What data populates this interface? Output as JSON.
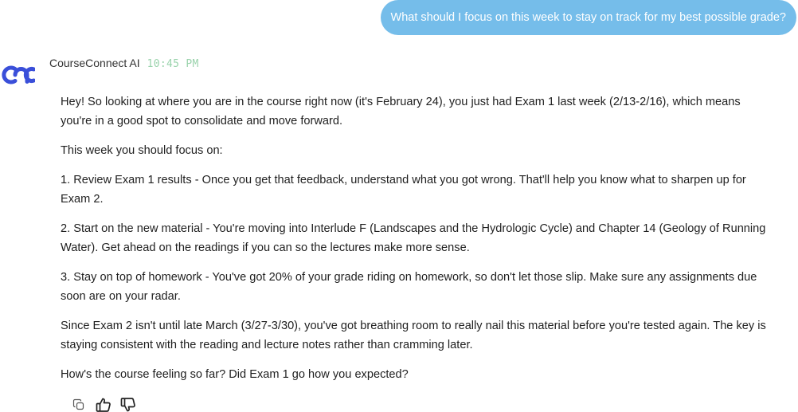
{
  "user_message": {
    "text": "What should I focus on this week to stay on track for my best possible grade?"
  },
  "assistant": {
    "name": "CourseConnect AI",
    "time": "10:45 PM",
    "avatar_icon": "courseconnect-logo",
    "paragraphs": [
      "Hey! So looking at where you are in the course right now (it's February 24), you just had Exam 1 last week (2/13-2/16), which means you're in a good spot to consolidate and move forward.",
      "This week you should focus on:",
      "1. Review Exam 1 results - Once you get that feedback, understand what you got wrong. That'll help you know what to sharpen up for Exam 2.",
      "2. Start on the new material - You're moving into Interlude F (Landscapes and the Hydrologic Cycle) and Chapter 14 (Geology of Running Water). Get ahead on the readings if you can so the lectures make more sense.",
      "3. Stay on top of homework - You've got 20% of your grade riding on homework, so don't let those slip. Make sure any assignments due soon are on your radar.",
      "Since Exam 2 isn't until late March (3/27-3/30), you've got breathing room to really nail this material before you're tested again. The key is staying consistent with the reading and lecture notes rather than cramming later.",
      "How's the course feeling so far? Did Exam 1 go how you expected?"
    ],
    "actions": [
      {
        "name": "copy",
        "icon": "copy-icon"
      },
      {
        "name": "thumbs-up",
        "icon": "thumbs-up-icon"
      },
      {
        "name": "thumbs-down",
        "icon": "thumbs-down-icon"
      }
    ]
  },
  "colors": {
    "user_bubble": "#75bdea",
    "logo": "#3a4fd9",
    "timestamp": "#9ad3ac"
  }
}
